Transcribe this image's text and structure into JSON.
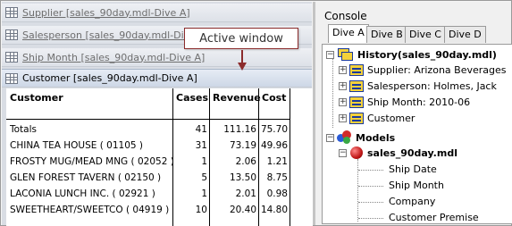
{
  "windows": {
    "stacked": [
      {
        "label": "Supplier [sales_90day.mdl-Dive A]"
      },
      {
        "label": "Salesperson [sales_90day.mdl-Dive A]"
      },
      {
        "label": "Ship Month [sales_90day.mdl-Dive A]"
      }
    ],
    "active": {
      "label": "Customer [sales_90day.mdl-Dive A]"
    }
  },
  "callout": {
    "text": "Active window"
  },
  "table": {
    "headers": {
      "customer": "Customer",
      "cases": "Cases",
      "revenue": "Revenue",
      "cost": "Cost"
    },
    "rows": [
      {
        "customer": "Totals",
        "cases": "41",
        "revenue": "111.16",
        "cost": "75.70"
      },
      {
        "customer": "CHINA TEA HOUSE  ( 01105 )",
        "cases": "31",
        "revenue": "73.19",
        "cost": "49.96"
      },
      {
        "customer": "FROSTY MUG/MEAD MNG  ( 02052 )",
        "cases": "1",
        "revenue": "2.06",
        "cost": "1.21"
      },
      {
        "customer": "GLEN FOREST TAVERN  ( 02150 )",
        "cases": "5",
        "revenue": "13.50",
        "cost": "8.75"
      },
      {
        "customer": "LACONIA LUNCH INC.  ( 02921 )",
        "cases": "1",
        "revenue": "2.01",
        "cost": "0.98"
      },
      {
        "customer": "SWEETHEART/SWEETCO  ( 04919 )",
        "cases": "10",
        "revenue": "20.40",
        "cost": "14.80"
      }
    ]
  },
  "console": {
    "title": "Console",
    "tabs": [
      "Dive A",
      "Dive B",
      "Dive C",
      "Dive D"
    ],
    "tree": {
      "history": "History(sales_90day.mdl)",
      "history_items": [
        "Supplier: Arizona Beverages",
        "Salesperson: Holmes, Jack",
        "Ship Month: 2010-06",
        "Customer"
      ],
      "models": "Models",
      "model": "sales_90day.mdl",
      "model_items": [
        "Ship Date",
        "Ship Month",
        "Company",
        "Customer Premise"
      ]
    }
  },
  "colors": {
    "callout_border": "#8b2c2c",
    "dimension_icon": "#f4d13a"
  }
}
